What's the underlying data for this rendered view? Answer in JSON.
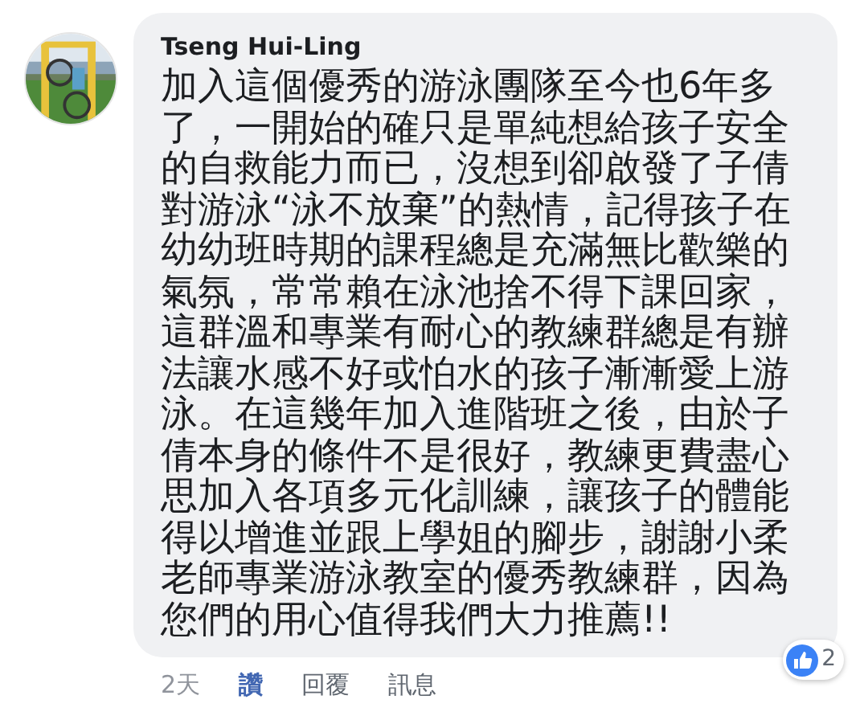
{
  "comment": {
    "author": "Tseng Hui-Ling",
    "text": "加入這個優秀的游泳團隊至今也6年多了，一開始的確只是單純想給孩子安全的自救能力而已，沒想到卻啟發了子倩對游泳“泳不放棄”的熱情，記得孩子在幼幼班時期的課程總是充滿無比歡樂的氣氛，常常賴在泳池捨不得下課回家，這群溫和專業有耐心的教練群總是有辦法讓水感不好或怕水的孩子漸漸愛上游泳。在這幾年加入進階班之後，由於子倩本身的條件不是很好，教練更費盡心思加入各項多元化訓練，讓孩子的體能得以增進並跟上學姐的腳步，謝謝小柔老師專業游泳教室的優秀教練群，因為您們的用心值得我們大力推薦!!",
    "reactions": {
      "count": "2"
    },
    "time": "2天",
    "actions": [
      {
        "label": "讚",
        "active": true
      },
      {
        "label": "回覆",
        "active": false
      },
      {
        "label": "訊息",
        "active": false
      }
    ]
  }
}
